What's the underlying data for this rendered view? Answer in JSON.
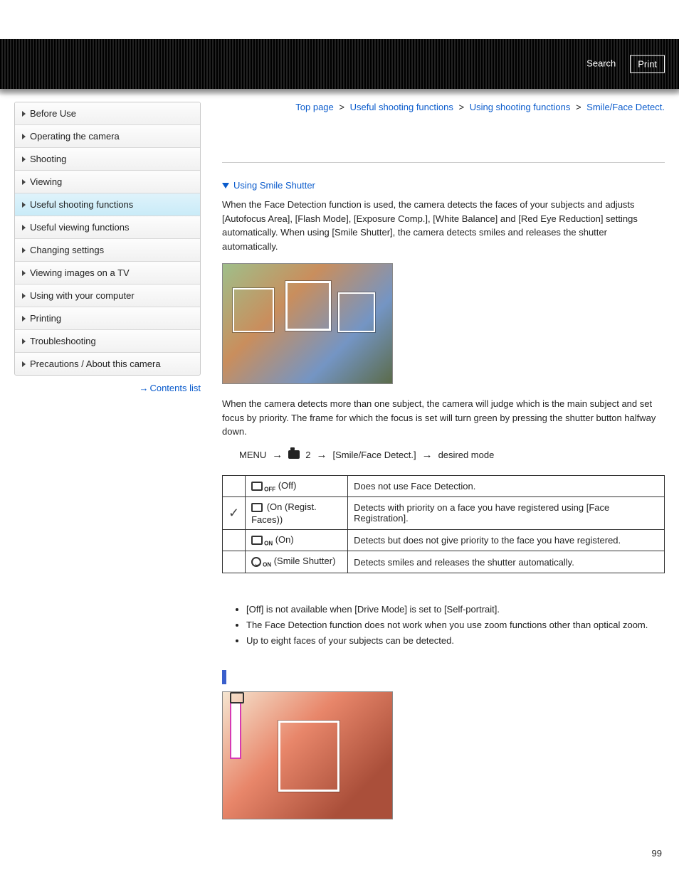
{
  "header": {
    "search": "Search",
    "print": "Print"
  },
  "breadcrumb": {
    "items": [
      "Top page",
      "Useful shooting functions",
      "Using shooting functions",
      "Smile/Face Detect."
    ],
    "sep": ">"
  },
  "sidebar": {
    "items": [
      {
        "label": "Before Use",
        "active": false
      },
      {
        "label": "Operating the camera",
        "active": false
      },
      {
        "label": "Shooting",
        "active": false
      },
      {
        "label": "Viewing",
        "active": false
      },
      {
        "label": "Useful shooting functions",
        "active": true
      },
      {
        "label": "Useful viewing functions",
        "active": false
      },
      {
        "label": "Changing settings",
        "active": false
      },
      {
        "label": "Viewing images on a TV",
        "active": false
      },
      {
        "label": "Using with your computer",
        "active": false
      },
      {
        "label": "Printing",
        "active": false
      },
      {
        "label": "Troubleshooting",
        "active": false
      },
      {
        "label": "Precautions / About this camera",
        "active": false
      }
    ],
    "contents_list": "Contents list"
  },
  "content": {
    "anchor_link": "Using Smile Shutter",
    "intro": "When the Face Detection function is used, the camera detects the faces of your subjects and adjusts [Autofocus Area], [Flash Mode], [Exposure Comp.], [White Balance] and [Red Eye Reduction] settings automatically. When using [Smile Shutter], the camera detects smiles and releases the shutter automatically.",
    "para2": "When the camera detects more than one subject, the camera will judge which is the main subject and set focus by priority. The frame for which the focus is set will turn green by pressing the shutter button halfway down.",
    "menu_path": {
      "menu": "MENU",
      "tab_num": "2",
      "item": "[Smile/Face Detect.]",
      "end": "desired mode"
    },
    "table": [
      {
        "checked": false,
        "icon_sub": "OFF",
        "name": "(Off)",
        "desc": "Does not use Face Detection."
      },
      {
        "checked": true,
        "icon_sub": "",
        "name": "(On (Regist. Faces))",
        "desc": "Detects with priority on a face you have registered using [Face Registration]."
      },
      {
        "checked": false,
        "icon_sub": "ON",
        "name": "(On)",
        "desc": "Detects but does not give priority to the face you have registered."
      },
      {
        "checked": false,
        "icon_sub": "ON",
        "smile": true,
        "name": "(Smile Shutter)",
        "desc": "Detects smiles and releases the shutter automatically."
      }
    ],
    "notes": [
      "[Off] is not available when [Drive Mode] is set to [Self-portrait].",
      "The Face Detection function does not work when you use zoom functions other than optical zoom.",
      "Up to eight faces of your subjects can be detected."
    ]
  },
  "page_number": "99"
}
